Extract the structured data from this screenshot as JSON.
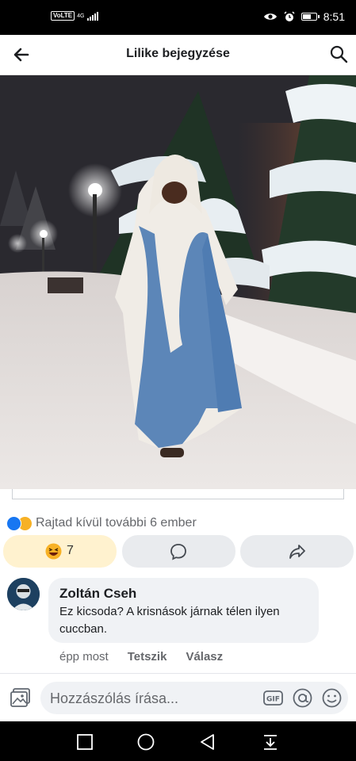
{
  "status_bar": {
    "volte": "VoLTE",
    "network": "4G",
    "time": "8:51",
    "battery_level": 0.55
  },
  "header": {
    "title": "Lilike bejegyzése",
    "back_icon": "arrow-left-icon",
    "search_icon": "search-icon"
  },
  "post": {
    "reactions_text": "Rajtad kívül további 6 ember",
    "reaction_icons": [
      "like-reaction-icon",
      "haha-reaction-icon"
    ],
    "reaction_count": "7",
    "colors": {
      "like": "#1877f2",
      "haha": "#f7b125",
      "haha_button_bg": "#fff2cf"
    }
  },
  "comment": {
    "author": "Zoltán Cseh",
    "text": "Ez kicsoda? A krisnások járnak télen ilyen cuccban.",
    "time": "épp most",
    "like_label": "Tetszik",
    "reply_label": "Válasz"
  },
  "composer": {
    "placeholder": "Hozzászólás írása..."
  }
}
